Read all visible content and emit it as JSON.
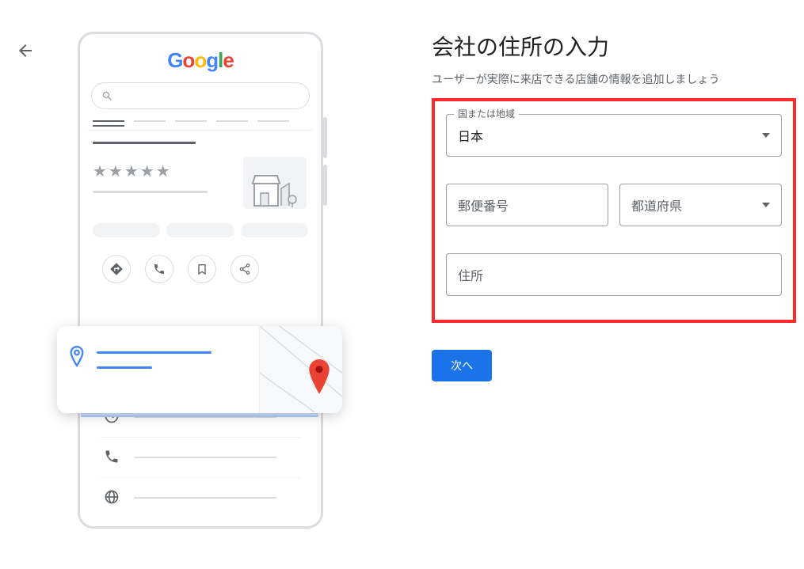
{
  "back_aria": "戻る",
  "form": {
    "title": "会社の住所の入力",
    "subtitle": "ユーザーが実際に来店できる店舗の情報を追加しましょう",
    "country_label": "国または地域",
    "country_value": "日本",
    "postal_placeholder": "郵便番号",
    "prefecture_placeholder": "都道府県",
    "address_placeholder": "住所",
    "next_label": "次へ"
  },
  "logo": {
    "g1": "G",
    "o1": "o",
    "o2": "o",
    "g2": "g",
    "l": "l",
    "e": "e"
  }
}
